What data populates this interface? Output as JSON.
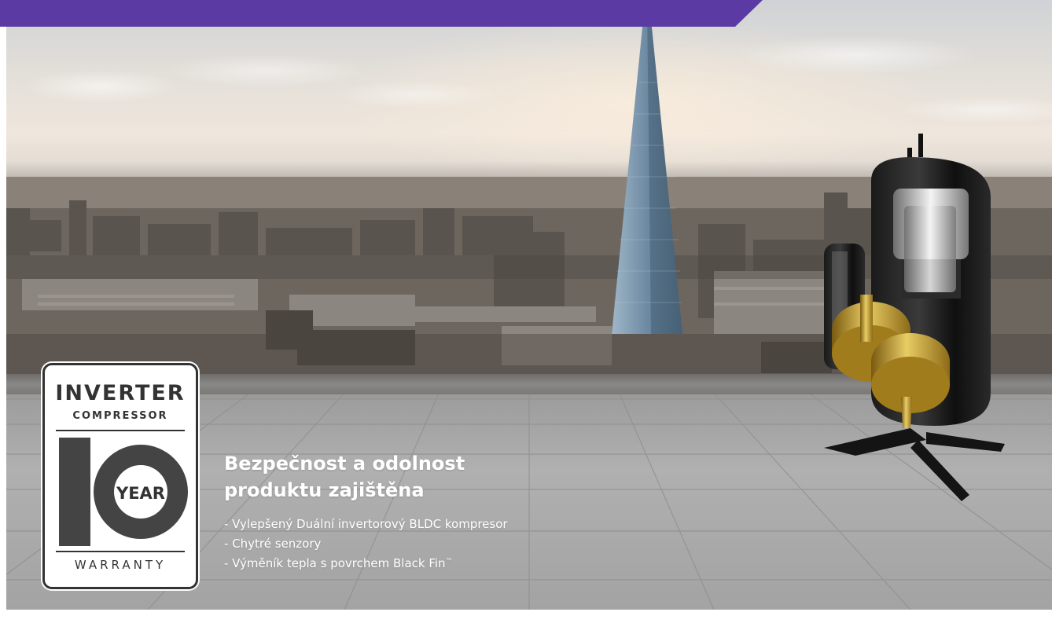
{
  "banner": {
    "text": "",
    "color": "#5b3aa3"
  },
  "badge": {
    "title": "INVERTER",
    "subtitle": "COMPRESSOR",
    "big_number": "10",
    "year": "YEAR",
    "footer": "WARRANTY"
  },
  "content": {
    "headline_line1": "Bezpečnost a odolnost",
    "headline_line2": "produktu zajištěna",
    "bullets": [
      "- Vylepšený Duální invertorový BLDC kompresor",
      "- Chytré senzory",
      "- Výměník tepla s povrchem Black Fin"
    ],
    "trademark": "™"
  },
  "icons": {
    "compressor": "inverter-compressor-illustration",
    "skyscraper": "shard-skyscraper"
  }
}
